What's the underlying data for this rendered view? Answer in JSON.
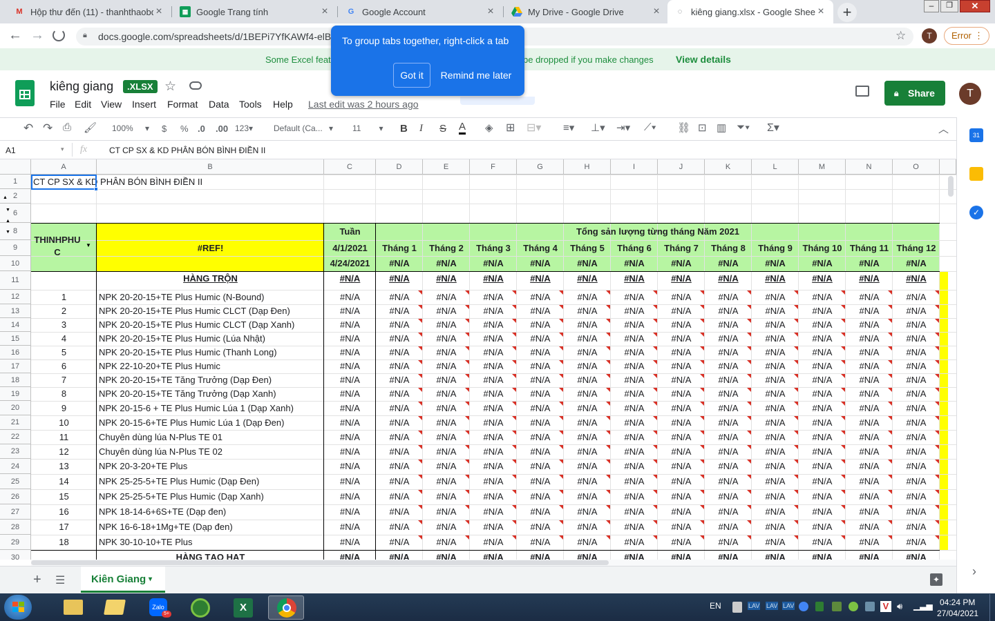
{
  "browser": {
    "tabs": [
      {
        "title": "Hộp thư đến (11) - thanhthaobd",
        "icon": "gmail-icon"
      },
      {
        "title": "Google Trang tính",
        "icon": "sheets-icon"
      },
      {
        "title": "Google Account",
        "icon": "google-icon"
      },
      {
        "title": "My Drive - Google Drive",
        "icon": "drive-icon"
      },
      {
        "title": "kiêng giang.xlsx - Google Sheets",
        "icon": "sheets-icon"
      }
    ],
    "url": "docs.google.com/spreadsheets/d/1BEPi7YfKAWf4-elBZ",
    "profile_initial": "T",
    "error_label": "Error"
  },
  "popup": {
    "text": "To group tabs together, right-click a tab",
    "got_it": "Got it",
    "remind": "Remind me later"
  },
  "banner": {
    "text_left": "Some Excel feat",
    "text_right": "be dropped if you make changes",
    "link": "View details"
  },
  "doc": {
    "title": "kiêng giang",
    "badge": ".XLSX",
    "menus": [
      "File",
      "Edit",
      "View",
      "Insert",
      "Format",
      "Data",
      "Tools",
      "Help"
    ],
    "last_edit": "Last edit was 2 hours ago",
    "share": "Share",
    "user_initial": "T"
  },
  "toolbar": {
    "zoom": "100%",
    "currency": "$",
    "percent": "%",
    "dec_less": ".0",
    "dec_more": ".00",
    "format123": "123",
    "font": "Default (Ca...",
    "font_size": "11",
    "bold": "B",
    "italic": "I",
    "strike": "S",
    "textcolor": "A"
  },
  "formula": {
    "cell_ref": "A1",
    "fx": "fx",
    "content": "CT CP SX & KD PHÂN BÓN BÌNH ĐIỀN II"
  },
  "columns": [
    "A",
    "B",
    "C",
    "D",
    "E",
    "F",
    "G",
    "H",
    "I",
    "J",
    "K",
    "L",
    "M",
    "N",
    "O"
  ],
  "rows_visible": [
    "1",
    "2",
    "6",
    "8",
    "9",
    "10",
    "11",
    "12",
    "13",
    "14",
    "15",
    "16",
    "17",
    "18",
    "19",
    "20",
    "21",
    "22",
    "23",
    "24",
    "25",
    "26",
    "27",
    "28",
    "29",
    "30"
  ],
  "sheet": {
    "a1": "CT CP SX & KD PHÂN BÓN BÌNH ĐIỀN II",
    "header_a": "THINHPHU C",
    "header_b": "#REF!",
    "tuan": "Tuần",
    "date_start": "4/1/2021",
    "date_end": "4/24/2021",
    "total_title": "Tổng sản lượng từng tháng Năm 2021",
    "months": [
      "Tháng 1",
      "Tháng 2",
      "Tháng 3",
      "Tháng 4",
      "Tháng 5",
      "Tháng 6",
      "Tháng 7",
      "Tháng 8",
      "Tháng 9",
      "Tháng 10",
      "Tháng 11",
      "Tháng 12"
    ],
    "na": "#N/A",
    "section1": "HÀNG TRỘN",
    "section2": "HÀNG TẠO HẠT",
    "items": [
      {
        "no": "1",
        "name": "NPK 20-20-15+TE Plus Humic (N-Bound)"
      },
      {
        "no": "2",
        "name": "NPK 20-20-15+TE Plus Humic CLCT (Dạp Đen)"
      },
      {
        "no": "3",
        "name": "NPK 20-20-15+TE Plus Humic CLCT (Dạp Xanh)"
      },
      {
        "no": "4",
        "name": "NPK 20-20-15+TE Plus Humic (Lúa Nhật)"
      },
      {
        "no": "5",
        "name": "NPK 20-20-15+TE Plus Humic (Thanh Long)"
      },
      {
        "no": "6",
        "name": "NPK 22-10-20+TE Plus Humic"
      },
      {
        "no": "7",
        "name": "NPK 20-20-15+TE Tăng Trưởng (Dạp Đen)"
      },
      {
        "no": "8",
        "name": "NPK 20-20-15+TE Tăng Trưởng (Dạp Xanh)"
      },
      {
        "no": "9",
        "name": "NPK 20-15-6 + TE Plus Humic Lúa 1 (Dạp Xanh)"
      },
      {
        "no": "10",
        "name": "NPK 20-15-6+TE Plus Humic Lúa 1 (Dạp Đen)"
      },
      {
        "no": "11",
        "name": "Chuyên dùng lúa N-Plus TE 01"
      },
      {
        "no": "12",
        "name": "Chuyên dùng lúa N-Plus TE 02"
      },
      {
        "no": "13",
        "name": "NPK 20-3-20+TE Plus"
      },
      {
        "no": "14",
        "name": "NPK 25-25-5+TE Plus Humic (Dạp Đen)"
      },
      {
        "no": "15",
        "name": "NPK 25-25-5+TE Plus Humic (Dạp Xanh)"
      },
      {
        "no": "16",
        "name": "NPK 18-14-6+6S+TE (Dạp đen)"
      },
      {
        "no": "17",
        "name": "NPK 16-6-18+1Mg+TE (Dạp đen)"
      },
      {
        "no": "18",
        "name": "NPK 30-10-10+TE Plus"
      }
    ]
  },
  "sheet_tab": "Kiên Giang",
  "taskbar": {
    "lang": "EN",
    "time": "04:24 PM",
    "date": "27/04/2021"
  },
  "colors": {
    "green_header": "#b7f5a2",
    "yellow": "#ffff00",
    "sheets_green": "#188038",
    "popup_blue": "#1a73e8"
  }
}
